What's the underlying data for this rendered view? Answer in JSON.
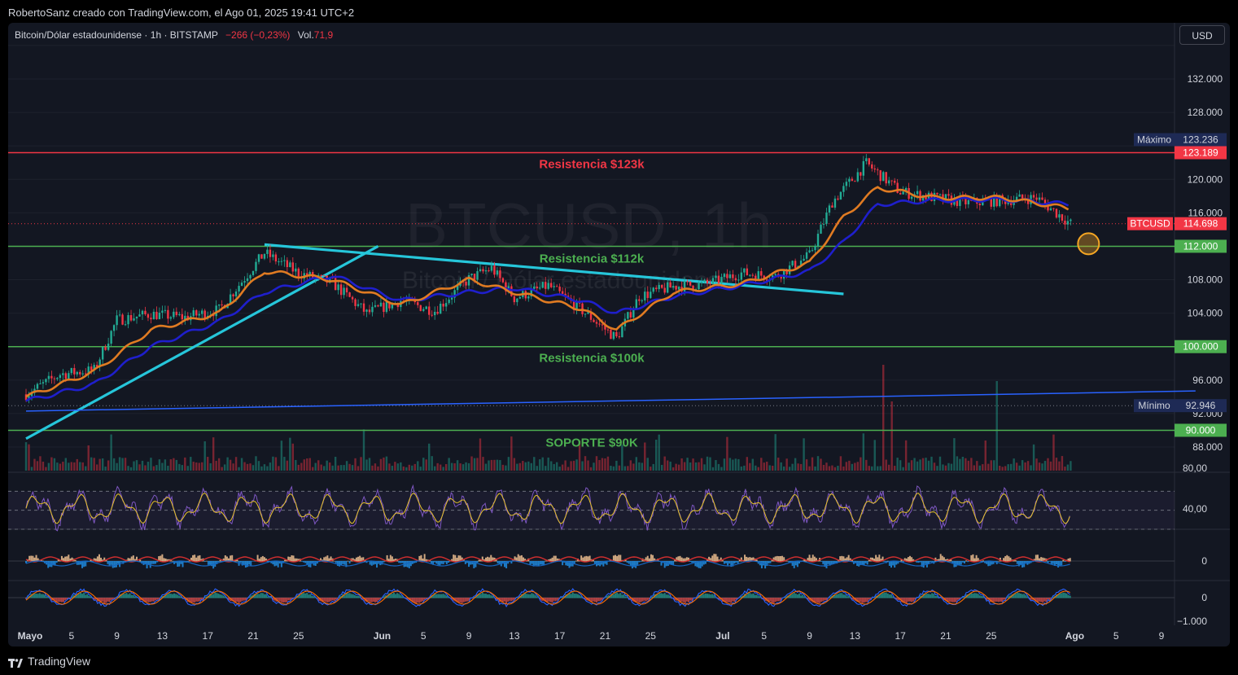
{
  "header": {
    "attribution": "RobertoSanz creado con TradingView.com, el Ago 01, 2025 19:41 UTC+2"
  },
  "legend": {
    "symbol": "Bitcoin/Dólar estadounidense · 1h · BITSTAMP",
    "change": "−266 (−0,23%)",
    "volume_label": "Vol.",
    "volume_value": "71,9"
  },
  "currency_button": "USD",
  "watermark": {
    "ticker": "BTCUSD, 1h",
    "name": "Bitcoin / Dólar estadounidense"
  },
  "brand": "TradingView",
  "colors": {
    "background": "#131722",
    "resistance_red": "#f23645",
    "support_green": "#4caf50",
    "trendline_cyan": "#26c6da",
    "ma_fast_orange": "#e07b22",
    "ma_slow_blue": "#1f1fcc",
    "long_trend_blue": "#2962ff",
    "price_label_red": "#f23645",
    "marker_orange": "#f5a623"
  },
  "chart_data": {
    "type": "candlestick",
    "symbol": "BTCUSD",
    "interval": "1h",
    "exchange": "BITSTAMP",
    "y_axis": {
      "ticks": [
        "132.000",
        "128.000",
        "120.000",
        "116.000",
        "108.000",
        "104.000",
        "96.000",
        "92.000",
        "88.000"
      ],
      "ylim": [
        86000,
        137000
      ]
    },
    "x_axis": {
      "ticks": [
        "Mayo",
        "5",
        "9",
        "13",
        "17",
        "21",
        "25",
        "Jun",
        "5",
        "9",
        "13",
        "17",
        "21",
        "25",
        "Jul",
        "5",
        "9",
        "13",
        "17",
        "21",
        "25",
        "Ago",
        "5",
        "9"
      ]
    },
    "price_series": {
      "x": [
        "2025-05-01",
        "2025-05-04",
        "2025-05-07",
        "2025-05-09",
        "2025-05-12",
        "2025-05-15",
        "2025-05-18",
        "2025-05-21",
        "2025-05-22",
        "2025-05-25",
        "2025-05-28",
        "2025-05-31",
        "2025-06-03",
        "2025-06-06",
        "2025-06-09",
        "2025-06-11",
        "2025-06-13",
        "2025-06-16",
        "2025-06-19",
        "2025-06-22",
        "2025-06-24",
        "2025-06-27",
        "2025-06-30",
        "2025-07-03",
        "2025-07-06",
        "2025-07-09",
        "2025-07-11",
        "2025-07-14",
        "2025-07-17",
        "2025-07-20",
        "2025-07-23",
        "2025-07-26",
        "2025-07-29",
        "2025-08-01"
      ],
      "close": [
        94300,
        96700,
        97200,
        103200,
        103900,
        103500,
        104400,
        109500,
        111200,
        108800,
        107600,
        104000,
        105500,
        104300,
        108100,
        109400,
        105800,
        107300,
        104300,
        101000,
        106000,
        107200,
        107500,
        108800,
        108400,
        110900,
        117300,
        121900,
        118500,
        117800,
        117200,
        117500,
        117800,
        114700
      ]
    },
    "ma_fast": {
      "x": [
        "2025-05-01",
        "2025-05-07",
        "2025-05-12",
        "2025-05-18",
        "2025-05-22",
        "2025-05-28",
        "2025-06-03",
        "2025-06-09",
        "2025-06-13",
        "2025-06-19",
        "2025-06-22",
        "2025-06-27",
        "2025-07-03",
        "2025-07-09",
        "2025-07-12",
        "2025-07-15",
        "2025-07-20",
        "2025-07-26",
        "2025-08-01"
      ],
      "values": [
        94000,
        97000,
        102000,
        104000,
        109000,
        108000,
        105000,
        108000,
        106500,
        104500,
        102000,
        106500,
        107500,
        110000,
        115500,
        119000,
        117800,
        117800,
        116500
      ]
    },
    "ma_slow": {
      "x": [
        "2025-05-01",
        "2025-05-07",
        "2025-05-12",
        "2025-05-18",
        "2025-05-22",
        "2025-05-28",
        "2025-06-03",
        "2025-06-09",
        "2025-06-13",
        "2025-06-19",
        "2025-06-22",
        "2025-06-27",
        "2025-07-03",
        "2025-07-09",
        "2025-07-12",
        "2025-07-15",
        "2025-07-20",
        "2025-07-26",
        "2025-08-01"
      ],
      "values": [
        93500,
        95500,
        100000,
        103000,
        106500,
        108500,
        105500,
        106500,
        107000,
        105500,
        104000,
        106000,
        107300,
        109000,
        112500,
        117000,
        117500,
        117600,
        117000
      ]
    },
    "horizontal_lines": [
      {
        "label": "Resistencia $123k",
        "value": 123189,
        "price_tag": "123.189",
        "color": "#f23645"
      },
      {
        "label": "Resistencia $112k",
        "value": 112000,
        "price_tag": "112.000",
        "color": "#4caf50"
      },
      {
        "label": "Resistencia $100k",
        "value": 100000,
        "price_tag": "100.000",
        "color": "#4caf50"
      },
      {
        "label": "SOPORTE $90K",
        "value": 90000,
        "price_tag": "90.000",
        "color": "#4caf50"
      }
    ],
    "trendlines": [
      {
        "from": {
          "x": "2025-05-01",
          "y": 89000
        },
        "to": {
          "x": "2025-06-01",
          "y": 112000
        },
        "color": "#26c6da"
      },
      {
        "from": {
          "x": "2025-05-22",
          "y": 112200
        },
        "to": {
          "x": "2025-07-12",
          "y": 106300
        },
        "color": "#26c6da"
      },
      {
        "from": {
          "x": "2025-05-01",
          "y": 92300
        },
        "to": {
          "x": "2025-08-12",
          "y": 94700
        },
        "color": "#2962ff"
      }
    ],
    "price_labels": {
      "max": {
        "label": "Máximo",
        "value": "123.236"
      },
      "min": {
        "label": "Mínimo",
        "value": "92.946"
      },
      "last": {
        "label": "BTCUSD",
        "value": "114.698"
      }
    },
    "marker": {
      "x": "2025-08-02",
      "y": 112300
    },
    "indicators": [
      {
        "name": "oscillator",
        "ticks": [
          "80,00",
          "40,00"
        ]
      },
      {
        "name": "momentum",
        "ticks": [
          "0"
        ]
      },
      {
        "name": "macd",
        "ticks": [
          "0",
          "−1.000"
        ]
      }
    ]
  }
}
